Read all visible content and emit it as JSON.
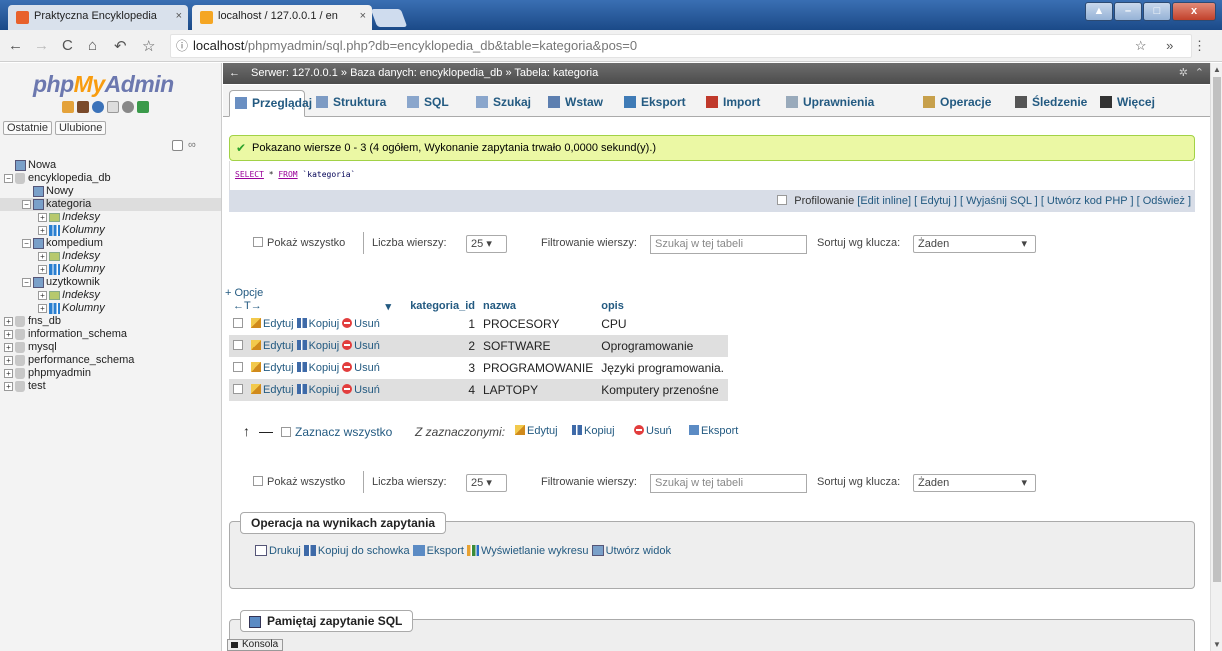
{
  "browser": {
    "tabs": [
      {
        "title": "Praktyczna Encyklopedia",
        "close": "×"
      },
      {
        "title": "localhost / 127.0.0.1 / en",
        "close": "×"
      }
    ],
    "nav_glyphs": [
      "←",
      "→",
      "C",
      "⌂",
      "↶",
      "☆"
    ],
    "url_prefix": "localhost",
    "url_rest": "/phpmyadmin/sql.php?db=encyklopedia_db&table=kategoria&pos=0",
    "info_glyph": "ⓘ",
    "window_buttons": [
      "▲",
      "–",
      "□",
      "x"
    ],
    "right_glyphs": "☆ » ⋮"
  },
  "sidebar": {
    "logo_php": "php",
    "logo_my": "My",
    "logo_admin": "Admin",
    "recent": "Ostatnie",
    "favourites": "Ulubione",
    "tree": [
      {
        "label": "Nowa",
        "level": 0,
        "kind": "new"
      },
      {
        "label": "encyklopedia_db",
        "level": 0,
        "kind": "db",
        "expand": "−"
      },
      {
        "label": "Nowy",
        "level": 1,
        "kind": "new"
      },
      {
        "label": "kategoria",
        "level": 1,
        "kind": "table",
        "expand": "−",
        "selected": true
      },
      {
        "label": "Indeksy",
        "level": 2,
        "kind": "index",
        "expand": "+"
      },
      {
        "label": "Kolumny",
        "level": 2,
        "kind": "cols",
        "expand": "+"
      },
      {
        "label": "kompedium",
        "level": 1,
        "kind": "table",
        "expand": "−"
      },
      {
        "label": "Indeksy",
        "level": 2,
        "kind": "index",
        "expand": "+"
      },
      {
        "label": "Kolumny",
        "level": 2,
        "kind": "cols",
        "expand": "+"
      },
      {
        "label": "uzytkownik",
        "level": 1,
        "kind": "table",
        "expand": "−"
      },
      {
        "label": "Indeksy",
        "level": 2,
        "kind": "index",
        "expand": "+"
      },
      {
        "label": "Kolumny",
        "level": 2,
        "kind": "cols",
        "expand": "+"
      },
      {
        "label": "fns_db",
        "level": 0,
        "kind": "db",
        "expand": "+"
      },
      {
        "label": "information_schema",
        "level": 0,
        "kind": "db",
        "expand": "+"
      },
      {
        "label": "mysql",
        "level": 0,
        "kind": "db",
        "expand": "+"
      },
      {
        "label": "performance_schema",
        "level": 0,
        "kind": "db",
        "expand": "+"
      },
      {
        "label": "phpmyadmin",
        "level": 0,
        "kind": "db",
        "expand": "+"
      },
      {
        "label": "test",
        "level": 0,
        "kind": "db",
        "expand": "+"
      }
    ]
  },
  "breadcrumb": {
    "back": "←",
    "server": "Serwer: 127.0.0.1",
    "database": "Baza danych: encyklopedia_db",
    "table": "Tabela: kategoria",
    "sep": "»",
    "gear": "✲",
    "up": "⌃"
  },
  "tabs": [
    {
      "label": "Przeglądaj",
      "color": "#6a8fc2"
    },
    {
      "label": "Struktura",
      "color": "#7d9bc4"
    },
    {
      "label": "SQL",
      "color": "#8aa6cc"
    },
    {
      "label": "Szukaj",
      "color": "#8aa6cc"
    },
    {
      "label": "Wstaw",
      "color": "#5d7fb0"
    },
    {
      "label": "Eksport",
      "color": "#3f7bb6"
    },
    {
      "label": "Import",
      "color": "#c0392b"
    },
    {
      "label": "Uprawnienia",
      "color": "#9ab"
    },
    {
      "label": "Operacje",
      "color": "#c7a04b"
    },
    {
      "label": "Śledzenie",
      "color": "#555"
    },
    {
      "label": "Więcej",
      "color": "#333"
    }
  ],
  "success_message": "Pokazano wiersze 0 - 3 (4 ogółem, Wykonanie zapytania trwało 0,0000 sekund(y).)",
  "success_check": "✔",
  "sql": {
    "kw1": "SELECT",
    "rest1": " * ",
    "kw2": "FROM",
    "table": " `kategoria`"
  },
  "toolsbar": {
    "profiling": "Profilowanie",
    "links": [
      "[Edit inline]",
      "[ Edytuj ]",
      "[ Wyjaśnij SQL ]",
      "[ Utwórz kod PHP ]",
      "[ Odśwież ]"
    ]
  },
  "navrow": {
    "show_all": "Pokaż wszystko",
    "rows_label": "Liczba wierszy:",
    "rows_value": "25",
    "filter_label": "Filtrowanie wierszy:",
    "filter_placeholder": "Szukaj w tej tabeli",
    "sort_label": "Sortuj wg klucza:",
    "sort_value": "Żaden",
    "dropdown": "▾"
  },
  "options_link": "+ Opcje",
  "arrows": "←T→",
  "columns": {
    "sort_arrow": "▾",
    "c1": "kategoria_id",
    "c2": "nazwa",
    "c3": "opis"
  },
  "row_actions": {
    "edit": "Edytuj",
    "copy": "Kopiuj",
    "delete": "Usuń"
  },
  "rows": [
    {
      "id": "1",
      "nazwa": "PROCESORY",
      "opis": "CPU"
    },
    {
      "id": "2",
      "nazwa": "SOFTWARE",
      "opis": "Oprogramowanie"
    },
    {
      "id": "3",
      "nazwa": "PROGRAMOWANIE",
      "opis": "Języki programowania."
    },
    {
      "id": "4",
      "nazwa": "LAPTOPY",
      "opis": "Komputery przenośne"
    }
  ],
  "bulk": {
    "arrow": "↑",
    "select_all": "Zaznacz wszystko",
    "with_selected": "Z zaznaczonymi:",
    "edit": "Edytuj",
    "copy": "Kopiuj",
    "delete": "Usuń",
    "export": "Eksport"
  },
  "query_ops": {
    "legend": "Operacja na wynikach zapytania",
    "print": "Drukuj",
    "copy": "Kopiuj do schowka",
    "export": "Eksport",
    "chart": "Wyświetlanie wykresu",
    "view": "Utwórz widok"
  },
  "bookmark": {
    "legend": "Pamiętaj zapytanie SQL"
  },
  "console": "Konsola",
  "scroll_up": "▲",
  "scroll_down": "▼"
}
